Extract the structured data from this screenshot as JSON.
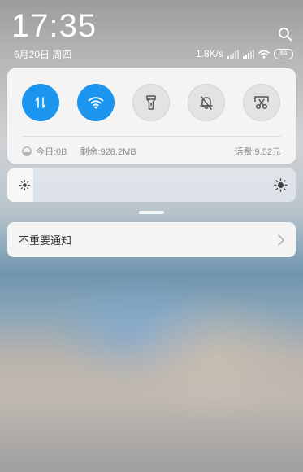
{
  "clock": {
    "time": "17:35",
    "date": "6月20日 周四"
  },
  "status_bar": {
    "net_speed": "1.8K/s",
    "battery_level": "84",
    "icons": [
      "signal-icon",
      "signal-icon",
      "wifi-icon",
      "battery-icon"
    ]
  },
  "quick_toggles": [
    {
      "name": "mobile-data-toggle",
      "icon": "data-arrows-icon",
      "active": true
    },
    {
      "name": "wifi-toggle",
      "icon": "wifi-icon",
      "active": true
    },
    {
      "name": "flashlight-toggle",
      "icon": "flashlight-icon",
      "active": false
    },
    {
      "name": "mute-toggle",
      "icon": "bell-off-icon",
      "active": false
    },
    {
      "name": "screenshot-toggle",
      "icon": "scissors-icon",
      "active": false
    }
  ],
  "usage": {
    "today": "今日:0B",
    "remaining": "剩余:928.2MB",
    "phone_balance": "话费:9.52元"
  },
  "brightness": {
    "level": 0.09
  },
  "notification": {
    "label": "不重要通知"
  },
  "colors": {
    "accent": "#1b95ee",
    "panel": "#f4f4f4",
    "text": "#333333"
  }
}
